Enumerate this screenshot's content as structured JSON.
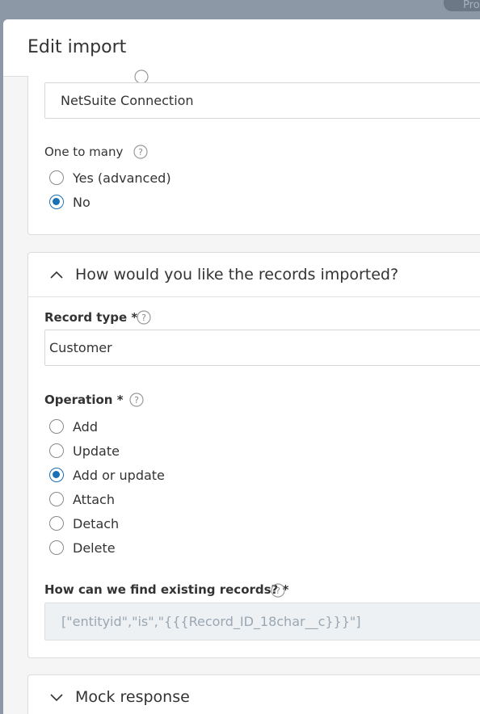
{
  "backdrop": {
    "tab_label": "Pro"
  },
  "drawer": {
    "title": "Edit import"
  },
  "connection_section": {
    "connection_value": "NetSuite Connection",
    "one_to_many": {
      "label": "One to many",
      "options": [
        {
          "label": "Yes (advanced)",
          "checked": false
        },
        {
          "label": "No",
          "checked": true
        }
      ]
    }
  },
  "records_section": {
    "title": "How would you like the records imported?",
    "record_type": {
      "label": "Record type *",
      "value": "Customer"
    },
    "operation": {
      "label": "Operation *",
      "options": [
        {
          "label": "Add",
          "checked": false
        },
        {
          "label": "Update",
          "checked": false
        },
        {
          "label": "Add or update",
          "checked": true
        },
        {
          "label": "Attach",
          "checked": false
        },
        {
          "label": "Detach",
          "checked": false
        },
        {
          "label": "Delete",
          "checked": false
        }
      ]
    },
    "find_existing": {
      "label": "How can we find existing records? *",
      "value": "[\"entityid\",\"is\",\"{{{Record_ID_18char__c}}}\"]"
    }
  },
  "mock_section": {
    "title": "Mock response"
  },
  "colors": {
    "accent": "#1b6fb5",
    "backdrop": "#8c98a6",
    "drawer_bg": "#f5f5f5"
  }
}
